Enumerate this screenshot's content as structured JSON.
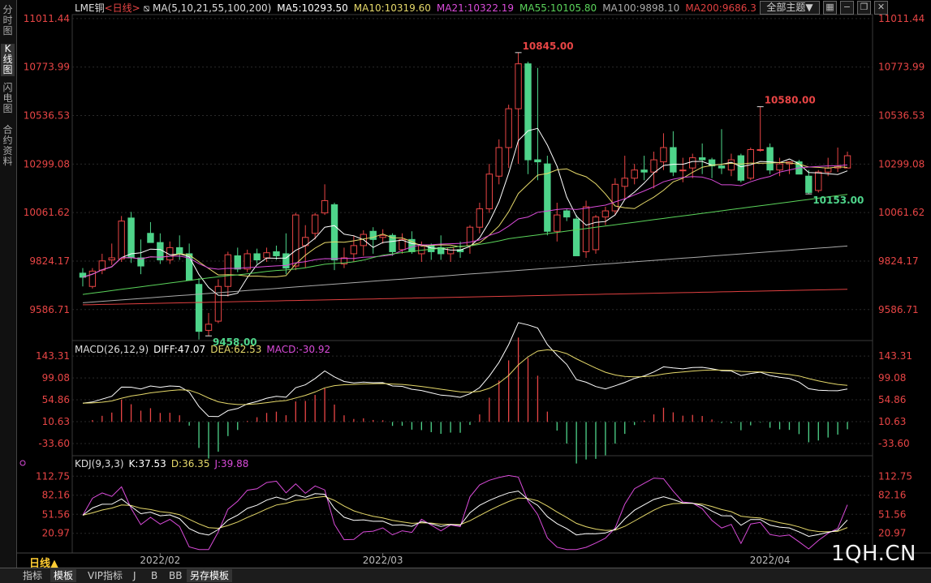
{
  "sidebar": {
    "tabs": [
      "分时图",
      "K线图",
      "闪电图",
      "合约资料"
    ],
    "active": 1
  },
  "header": {
    "symbol": "LME铜",
    "period_tag": "<日线>",
    "ma_params": "MA(5,10,21,55,100,200)",
    "ma_values": [
      {
        "label": "MA5:10293.50",
        "color": "#ffffff"
      },
      {
        "label": "MA10:10319.60",
        "color": "#e6d96a"
      },
      {
        "label": "MA21:10322.19",
        "color": "#d94bd9"
      },
      {
        "label": "MA55:10105.80",
        "color": "#5bd45b"
      },
      {
        "label": "MA100:9898.10",
        "color": "#aaaaaa"
      },
      {
        "label": "MA200:9686.3",
        "color": "#e04040"
      }
    ],
    "theme_button": "全部主题▼",
    "tool_icons": [
      "grid-icon",
      "zoom-out-icon",
      "restore-icon",
      "close-icon"
    ]
  },
  "colors": {
    "up": "#e84545",
    "down": "#4ed48a",
    "axis_text": "#e84545",
    "grid": "#2a2a2a"
  },
  "chart_data": [
    {
      "type": "candlestick",
      "title": "LME铜<日线>",
      "y_ticks": [
        11011.44,
        10773.99,
        10536.53,
        10299.08,
        10061.62,
        9824.17,
        9586.71
      ],
      "ylim": [
        9435,
        11031
      ],
      "x_ticks": [
        "2022/02",
        "2022/03",
        "2022/04"
      ],
      "annotations": [
        {
          "label": "10845.00",
          "kind": "high"
        },
        {
          "label": "10580.00",
          "kind": "high"
        },
        {
          "label": "9458.00",
          "kind": "low"
        },
        {
          "label": "10153.00",
          "kind": "low"
        }
      ],
      "ohlc": [
        [
          9765,
          9790,
          9700,
          9745
        ],
        [
          9700,
          9790,
          9690,
          9775
        ],
        [
          9780,
          9860,
          9760,
          9825
        ],
        [
          9830,
          9910,
          9805,
          9840
        ],
        [
          9835,
          10045,
          9820,
          10020
        ],
        [
          10035,
          10065,
          9815,
          9840
        ],
        [
          9840,
          9930,
          9760,
          9800
        ],
        [
          9960,
          10015,
          9930,
          9915
        ],
        [
          9915,
          9960,
          9810,
          9830
        ],
        [
          9830,
          9920,
          9810,
          9890
        ],
        [
          9890,
          9950,
          9830,
          9860
        ],
        [
          9860,
          9910,
          9740,
          9730
        ],
        [
          9710,
          9740,
          9440,
          9480
        ],
        [
          9485,
          9570,
          9458,
          9515
        ],
        [
          9530,
          9735,
          9520,
          9700
        ],
        [
          9700,
          9870,
          9650,
          9855
        ],
        [
          9850,
          9890,
          9770,
          9785
        ],
        [
          9785,
          9880,
          9770,
          9860
        ],
        [
          9860,
          9885,
          9810,
          9830
        ],
        [
          9840,
          9890,
          9820,
          9865
        ],
        [
          9870,
          9900,
          9830,
          9850
        ],
        [
          9860,
          9960,
          9760,
          9790
        ],
        [
          9800,
          10060,
          9780,
          10050
        ],
        [
          9900,
          10000,
          9790,
          9940
        ],
        [
          9960,
          10060,
          9930,
          10050
        ],
        [
          10060,
          10200,
          10050,
          10120
        ],
        [
          10100,
          10110,
          9780,
          9830
        ],
        [
          9810,
          9890,
          9790,
          9840
        ],
        [
          9860,
          9950,
          9820,
          9900
        ],
        [
          9900,
          9975,
          9850,
          9955
        ],
        [
          9970,
          9990,
          9860,
          9930
        ],
        [
          9940,
          9980,
          9910,
          9950
        ],
        [
          9950,
          9960,
          9850,
          9870
        ],
        [
          9880,
          9960,
          9860,
          9930
        ],
        [
          9930,
          9970,
          9860,
          9870
        ],
        [
          9860,
          9920,
          9820,
          9900
        ],
        [
          9900,
          9910,
          9830,
          9870
        ],
        [
          9890,
          9950,
          9830,
          9860
        ],
        [
          9860,
          9895,
          9820,
          9890
        ],
        [
          9880,
          9920,
          9840,
          9870
        ],
        [
          9900,
          10000,
          9860,
          9990
        ],
        [
          9990,
          10110,
          9960,
          10080
        ],
        [
          10080,
          10300,
          10060,
          10250
        ],
        [
          10240,
          10420,
          10200,
          10380
        ],
        [
          10380,
          10590,
          10280,
          10570
        ],
        [
          10570,
          10845,
          10300,
          10790
        ],
        [
          10790,
          10800,
          10250,
          10320
        ],
        [
          10320,
          10770,
          10220,
          10310
        ],
        [
          10300,
          10340,
          9950,
          9970
        ],
        [
          9970,
          10110,
          9920,
          10050
        ],
        [
          10070,
          10080,
          10020,
          10040
        ],
        [
          10030,
          10050,
          9870,
          9850
        ],
        [
          9870,
          10120,
          9840,
          10090
        ],
        [
          9880,
          10050,
          9860,
          10040
        ],
        [
          10040,
          10090,
          10000,
          10070
        ],
        [
          10070,
          10230,
          10050,
          10200
        ],
        [
          10190,
          10340,
          10130,
          10230
        ],
        [
          10230,
          10300,
          10200,
          10270
        ],
        [
          10270,
          10340,
          10220,
          10260
        ],
        [
          10260,
          10360,
          10180,
          10320
        ],
        [
          10310,
          10450,
          10270,
          10380
        ],
        [
          10380,
          10460,
          10240,
          10260
        ],
        [
          10270,
          10330,
          10210,
          10270
        ],
        [
          10280,
          10350,
          10230,
          10330
        ],
        [
          10330,
          10400,
          10250,
          10320
        ],
        [
          10320,
          10330,
          10230,
          10290
        ],
        [
          10290,
          10470,
          10250,
          10280
        ],
        [
          10270,
          10350,
          10240,
          10320
        ],
        [
          10340,
          10350,
          10210,
          10220
        ],
        [
          10230,
          10380,
          10220,
          10370
        ],
        [
          10370,
          10580,
          10360,
          10370
        ],
        [
          10380,
          10400,
          10250,
          10270
        ],
        [
          10270,
          10330,
          10240,
          10300
        ],
        [
          10300,
          10310,
          10250,
          10310
        ],
        [
          10310,
          10320,
          10250,
          10250
        ],
        [
          10240,
          10270,
          10153,
          10160
        ],
        [
          10170,
          10270,
          10160,
          10260
        ],
        [
          10260,
          10330,
          10240,
          10280
        ],
        [
          10280,
          10380,
          10260,
          10290
        ],
        [
          10280,
          10360,
          10280,
          10340
        ]
      ],
      "series": [
        {
          "name": "MA5",
          "color": "#ffffff"
        },
        {
          "name": "MA10",
          "color": "#e6d96a"
        },
        {
          "name": "MA21",
          "color": "#d94bd9"
        },
        {
          "name": "MA55",
          "color": "#5bd45b"
        },
        {
          "name": "MA100",
          "color": "#aaaaaa"
        },
        {
          "name": "MA200",
          "color": "#e04040"
        }
      ]
    },
    {
      "type": "macd",
      "title": "MACD(26,12,9)",
      "values_text": [
        {
          "label": "DIFF:47.07",
          "color": "#ffffff"
        },
        {
          "label": "DEA:62.53",
          "color": "#e6d96a"
        },
        {
          "label": "MACD:-30.92",
          "color": "#d94bd9"
        }
      ],
      "y_ticks": [
        143.31,
        99.08,
        54.86,
        10.63,
        -33.6
      ],
      "ylim": [
        -55,
        155
      ]
    },
    {
      "type": "kdj",
      "title": "KDJ(9,3,3)",
      "values_text": [
        {
          "label": "K:37.53",
          "color": "#ffffff"
        },
        {
          "label": "D:36.35",
          "color": "#e6d96a"
        },
        {
          "label": "J:39.88",
          "color": "#d94bd9"
        }
      ],
      "y_ticks": [
        112.75,
        82.16,
        51.56,
        20.97
      ],
      "ylim": [
        -8,
        130
      ]
    }
  ],
  "footer": {
    "period": "日线▲",
    "tabs": [
      "指标",
      "模板",
      "VIP指标",
      "J",
      "B",
      "BB",
      "另存模板"
    ],
    "selected_tabs": [
      1,
      6
    ],
    "watermark": "1QH.CN"
  }
}
